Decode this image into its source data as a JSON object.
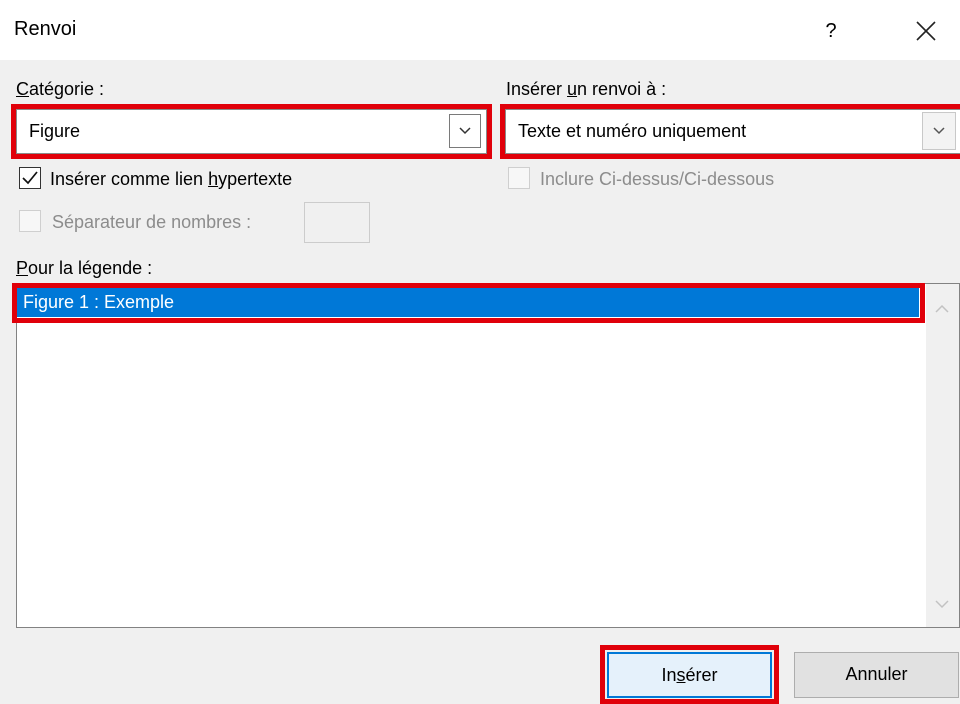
{
  "window": {
    "title": "Renvoi",
    "help_label": "?"
  },
  "category": {
    "label_underlined": "C",
    "label_rest": "atégorie :",
    "value": "Figure"
  },
  "insert_reference": {
    "label_before": "Insérer ",
    "label_underlined": "u",
    "label_after": "n renvoi à :",
    "value": "Texte et numéro uniquement"
  },
  "options": {
    "hyperlink_before": "Insérer comme lien ",
    "hyperlink_underlined": "h",
    "hyperlink_after": "ypertexte",
    "hyperlink_checked": true,
    "above_below_label": "Inclure Ci-dessus/Ci-dessous",
    "separator_label": "Séparateur de nombres :"
  },
  "caption_list": {
    "label_underlined": "P",
    "label_rest": "our la légende :",
    "items": [
      "Figure 1 : Exemple"
    ]
  },
  "buttons": {
    "insert_before": "In",
    "insert_underlined": "s",
    "insert_after": "érer",
    "cancel": "Annuler"
  },
  "colors": {
    "highlight_red": "#e0000a",
    "selection_blue": "#0078d7"
  }
}
